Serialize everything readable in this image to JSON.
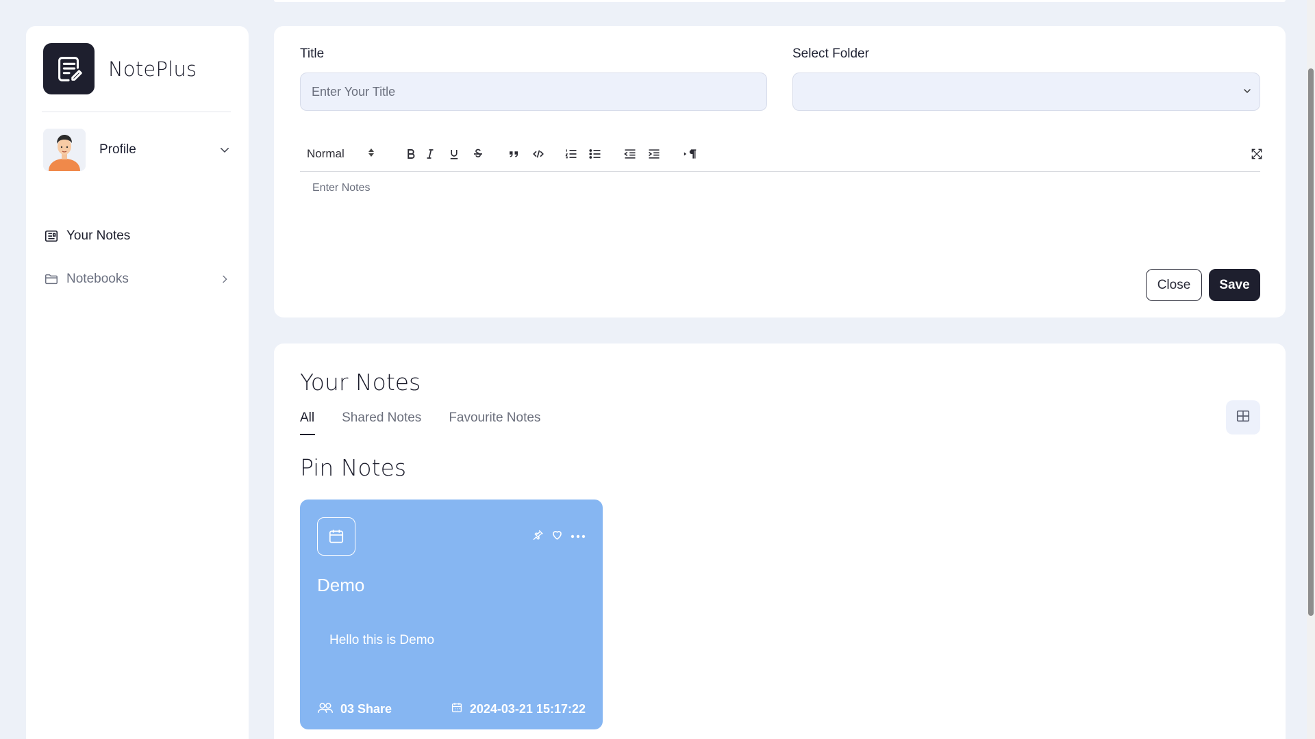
{
  "app": {
    "name": "NotePlus"
  },
  "sidebar": {
    "profile_label": "Profile",
    "items": [
      {
        "label": "Your Notes",
        "icon": "notes-icon"
      },
      {
        "label": "Notebooks",
        "icon": "folder-icon"
      }
    ]
  },
  "editor": {
    "title_label": "Title",
    "title_placeholder": "Enter Your Title",
    "folder_label": "Select Folder",
    "folder_value": "",
    "format_select": "Normal",
    "notes_placeholder": "Enter Notes",
    "close_label": "Close",
    "save_label": "Save"
  },
  "notes": {
    "heading": "Your Notes",
    "tabs": [
      {
        "label": "All",
        "active": true
      },
      {
        "label": "Shared Notes",
        "active": false
      },
      {
        "label": "Favourite Notes",
        "active": false
      }
    ],
    "pin_heading": "Pin Notes",
    "pinned": [
      {
        "title": "Demo",
        "body": "Hello this is Demo",
        "share": "03 Share",
        "date": "2024-03-21 15:17:22",
        "color": "#86b6f2"
      }
    ]
  },
  "colors": {
    "accent": "#1e1f2e",
    "background": "#edf1f8",
    "note_card": "#86b6f2"
  }
}
